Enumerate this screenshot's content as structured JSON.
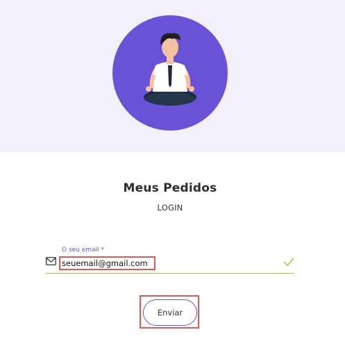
{
  "header": {
    "illustration": "meditating-man-icon",
    "accent_color": "#6a52d6",
    "background_color": "#f3f0fc"
  },
  "page": {
    "title": "Meus Pedidos",
    "subtitle": "LOGIN"
  },
  "form": {
    "email_label": "O seu email *",
    "email_value": "seuemail@gmail.com",
    "email_icon": "envelope-icon",
    "valid_icon": "checkmark-icon",
    "submit_label": "Enviar"
  }
}
